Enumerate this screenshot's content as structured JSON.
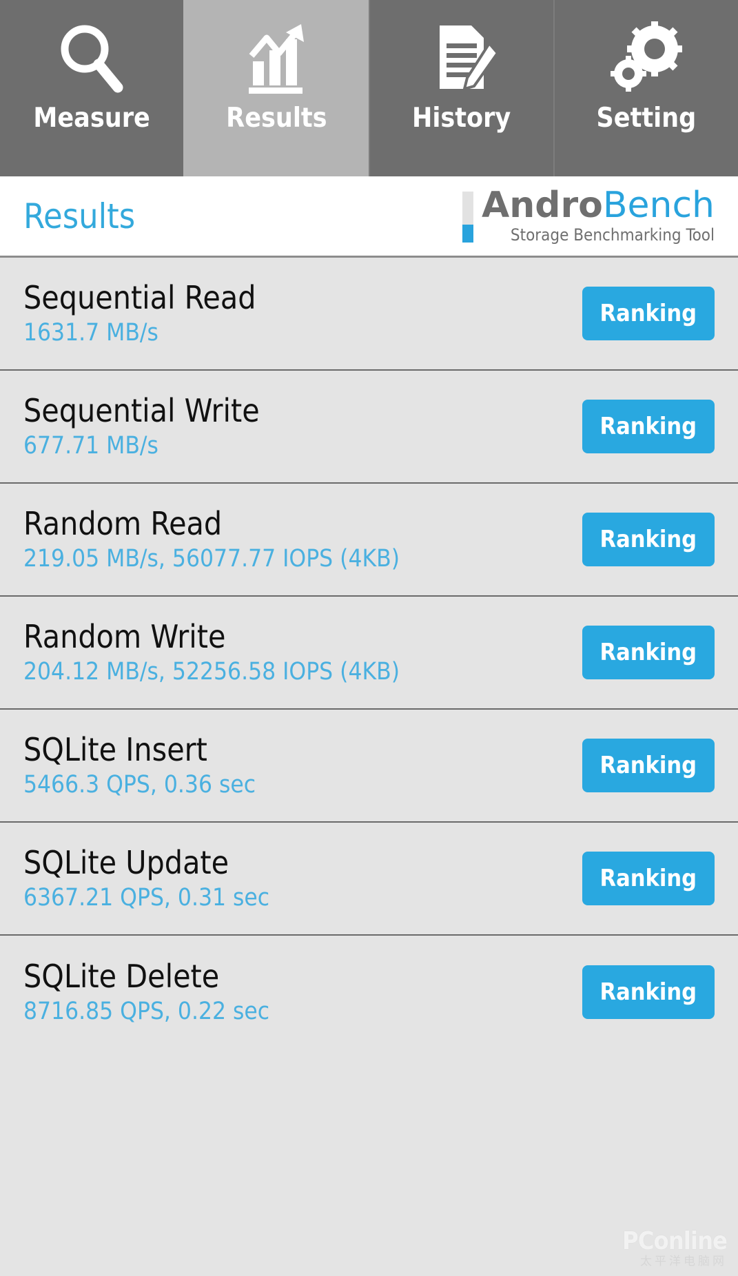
{
  "tabs": [
    {
      "label": "Measure",
      "icon": "magnifier-icon",
      "active": false
    },
    {
      "label": "Results",
      "icon": "bar-chart-icon",
      "active": true
    },
    {
      "label": "History",
      "icon": "document-pencil-icon",
      "active": false
    },
    {
      "label": "Setting",
      "icon": "gears-icon",
      "active": false
    }
  ],
  "header": {
    "title": "Results",
    "logo_primary": "Andro",
    "logo_secondary": "Bench",
    "logo_subtitle": "Storage Benchmarking Tool"
  },
  "results": [
    {
      "name": "Sequential Read",
      "value": "1631.7 MB/s",
      "button": "Ranking"
    },
    {
      "name": "Sequential Write",
      "value": "677.71 MB/s",
      "button": "Ranking"
    },
    {
      "name": "Random Read",
      "value": "219.05 MB/s, 56077.77 IOPS (4KB)",
      "button": "Ranking"
    },
    {
      "name": "Random Write",
      "value": "204.12 MB/s, 52256.58 IOPS (4KB)",
      "button": "Ranking"
    },
    {
      "name": "SQLite Insert",
      "value": "5466.3 QPS, 0.36 sec",
      "button": "Ranking"
    },
    {
      "name": "SQLite Update",
      "value": "6367.21 QPS, 0.31 sec",
      "button": "Ranking"
    },
    {
      "name": "SQLite Delete",
      "value": "8716.85 QPS, 0.22 sec",
      "button": "Ranking"
    }
  ],
  "watermark": {
    "main": "PConline",
    "sub": "太平洋电脑网"
  },
  "colors": {
    "accent": "#29a8e0",
    "value_text": "#4ab0e0",
    "tabbar_bg": "#6e6e6e",
    "tab_active_bg": "#b4b4b4",
    "list_bg": "#e4e4e4"
  }
}
